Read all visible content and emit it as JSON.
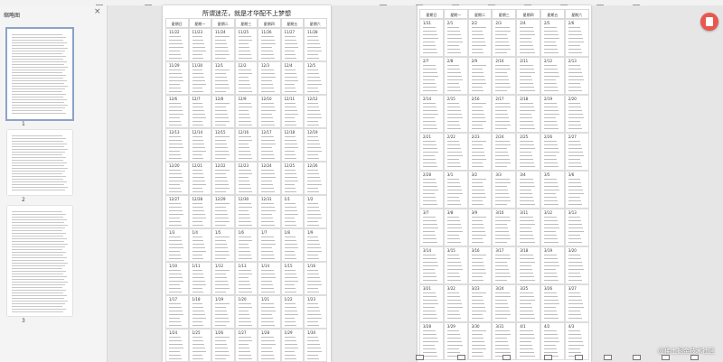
{
  "sidebar": {
    "title": "缩略图",
    "close": "×",
    "pages": [
      "1",
      "2",
      "3"
    ]
  },
  "page1": {
    "title": "所谓迷茫，就是才华配不上梦想",
    "weekdays": [
      "星期日",
      "星期一",
      "星期二",
      "星期三",
      "星期四",
      "星期五",
      "星期六"
    ],
    "rows": [
      [
        "11/22",
        "11/23",
        "11/24",
        "11/25",
        "11/26",
        "11/27",
        "11/28"
      ],
      [
        "11/29",
        "11/30",
        "12/1",
        "12/2",
        "12/3",
        "12/4",
        "12/5"
      ],
      [
        "12/6",
        "12/7",
        "12/8",
        "12/9",
        "12/10",
        "12/11",
        "12/12"
      ],
      [
        "12/13",
        "12/14",
        "12/15",
        "12/16",
        "12/17",
        "12/18",
        "12/19"
      ],
      [
        "12/20",
        "12/21",
        "12/22",
        "12/23",
        "12/24",
        "12/25",
        "12/26"
      ],
      [
        "12/27",
        "12/28",
        "12/29",
        "12/30",
        "12/31",
        "1/1",
        "1/2"
      ],
      [
        "1/3",
        "1/4",
        "1/5",
        "1/6",
        "1/7",
        "1/8",
        "1/9"
      ],
      [
        "1/10",
        "1/11",
        "1/12",
        "1/13",
        "1/14",
        "1/15",
        "1/16"
      ],
      [
        "1/17",
        "1/18",
        "1/19",
        "1/20",
        "1/21",
        "1/22",
        "1/23"
      ],
      [
        "1/24",
        "1/25",
        "1/26",
        "1/27",
        "1/28",
        "1/29",
        "1/30"
      ]
    ]
  },
  "page2": {
    "weekdays": [
      "星期日",
      "星期一",
      "星期二",
      "星期三",
      "星期四",
      "星期五",
      "星期六"
    ],
    "rows": [
      [
        "1/31",
        "2/1",
        "2/2",
        "2/3",
        "2/4",
        "2/5",
        "2/6"
      ],
      [
        "2/7",
        "2/8",
        "2/9",
        "2/10",
        "2/11",
        "2/12",
        "2/13"
      ],
      [
        "2/14",
        "2/15",
        "2/16",
        "2/17",
        "2/18",
        "2/19",
        "2/20"
      ],
      [
        "2/21",
        "2/22",
        "2/23",
        "2/24",
        "2/25",
        "2/26",
        "2/27"
      ],
      [
        "2/28",
        "3/1",
        "3/2",
        "3/3",
        "3/4",
        "3/5",
        "3/6"
      ],
      [
        "3/7",
        "3/8",
        "3/9",
        "3/10",
        "3/11",
        "3/12",
        "3/13"
      ],
      [
        "3/14",
        "3/15",
        "3/16",
        "3/17",
        "3/18",
        "3/19",
        "3/20"
      ],
      [
        "3/21",
        "3/22",
        "3/23",
        "3/24",
        "3/25",
        "3/26",
        "3/27"
      ],
      [
        "3/28",
        "3/29",
        "3/30",
        "3/31",
        "4/1",
        "4/2",
        "4/3"
      ]
    ]
  },
  "watermark": "@稀土掘金技术社区"
}
